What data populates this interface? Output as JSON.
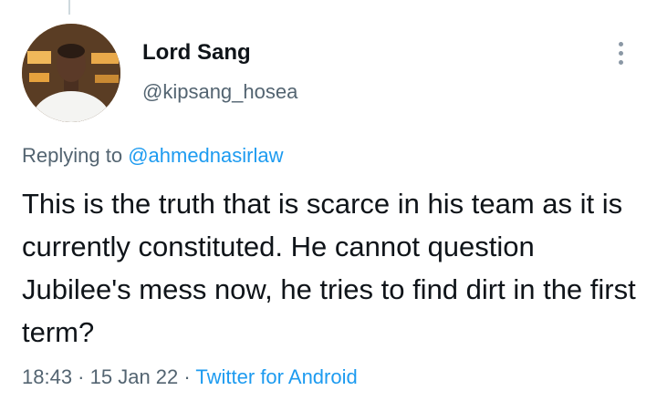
{
  "tweet": {
    "author": {
      "name": "Lord Sang",
      "handle": "@kipsang_hosea"
    },
    "reply_prefix": "Replying to ",
    "reply_to": "@ahmednasirlaw",
    "text": "This is the truth that is scarce in his team as it is currently constituted. He cannot question Jubilee's mess now, he tries to find dirt in the first term?",
    "time": "18:43",
    "date": "15 Jan 22",
    "separator": " · ",
    "source": "Twitter for Android"
  },
  "icons": {
    "more": "more-vertical-icon",
    "avatar": "avatar-photo"
  },
  "colors": {
    "text": "#0f1419",
    "secondary": "#536471",
    "link": "#1d9bf0"
  }
}
